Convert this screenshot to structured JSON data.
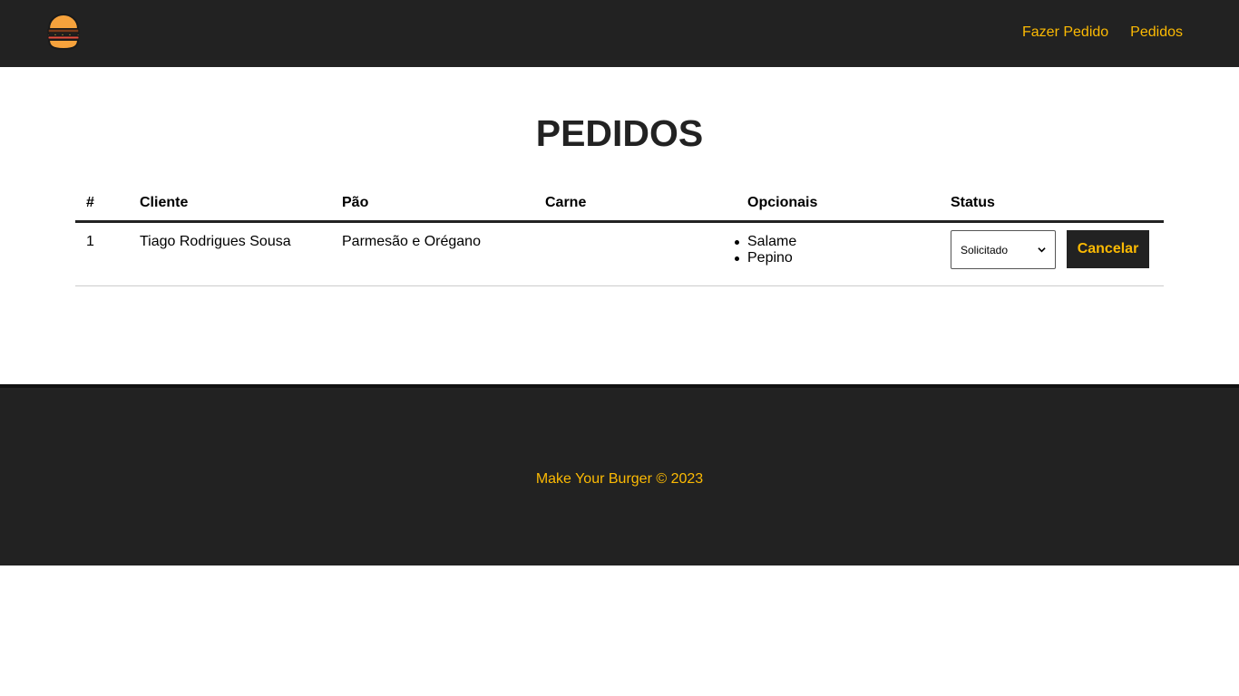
{
  "nav": {
    "logo_icon": "burger-icon",
    "links": [
      "Fazer Pedido",
      "Pedidos"
    ]
  },
  "page": {
    "title": "PEDIDOS"
  },
  "table": {
    "headers": [
      "#",
      "Cliente",
      "Pão",
      "Carne",
      "Opcionais",
      "Status"
    ],
    "rows": [
      {
        "id": "1",
        "cliente": "Tiago Rodrigues Sousa",
        "pao": "Parmesão e Orégano",
        "carne": "",
        "opcionais": [
          "Salame",
          "Pepino"
        ],
        "status": "Solicitado",
        "action_label": "Cancelar"
      }
    ]
  },
  "footer": {
    "text": "Make Your Burger © 2023"
  },
  "colors": {
    "dark": "#222222",
    "accent": "#fcba03"
  }
}
